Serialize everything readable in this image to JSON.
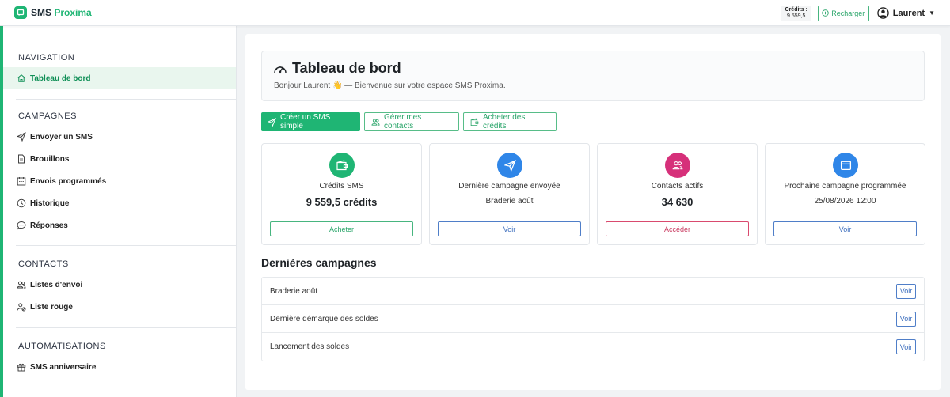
{
  "app": {
    "logo_prefix": "SMS",
    "logo_suffix": "Proxima",
    "brand_color": "#1fb574"
  },
  "topbar": {
    "credits_label": "Crédits :",
    "credits_value": "9 559,5",
    "recharge_label": "Recharger",
    "user_name": "Laurent"
  },
  "sidebar": {
    "sections": [
      {
        "heading": "NAVIGATION",
        "items": [
          {
            "label": "Tableau de bord",
            "icon": "home-icon",
            "active": true
          }
        ]
      },
      {
        "heading": "CAMPAGNES",
        "items": [
          {
            "label": "Envoyer un SMS",
            "icon": "send-icon"
          },
          {
            "label": "Brouillons",
            "icon": "file-icon"
          },
          {
            "label": "Envois programmés",
            "icon": "calendar-icon"
          },
          {
            "label": "Historique",
            "icon": "clock-icon"
          },
          {
            "label": "Réponses",
            "icon": "chat-icon"
          }
        ]
      },
      {
        "heading": "CONTACTS",
        "items": [
          {
            "label": "Listes d'envoi",
            "icon": "users-icon"
          },
          {
            "label": "Liste rouge",
            "icon": "user-block-icon"
          }
        ]
      },
      {
        "heading": "AUTOMATISATIONS",
        "items": [
          {
            "label": "SMS anniversaire",
            "icon": "gift-icon"
          }
        ]
      }
    ]
  },
  "header": {
    "title": "Tableau de bord",
    "subtitle": "Bonjour Laurent 👋 — Bienvenue sur votre espace SMS Proxima."
  },
  "actions": {
    "create_sms": "Créer un SMS simple",
    "manage_contacts": "Gérer mes contacts",
    "buy_credits": "Acheter des crédits"
  },
  "stats": [
    {
      "label": "Crédits SMS",
      "value": "9 559,5 crédits",
      "button": "Acheter",
      "color": "#1fb574",
      "btn_color": "#47b57f",
      "icon": "wallet-icon"
    },
    {
      "label": "Dernière campagne envoyée",
      "value": "Braderie août",
      "button": "Voir",
      "color": "#2f86e8",
      "btn_color": "#4f7ec8",
      "icon": "send-icon"
    },
    {
      "label": "Contacts actifs",
      "value": "34 630",
      "button": "Accéder",
      "color": "#d6307a",
      "btn_color": "#d94a6e",
      "icon": "users-icon"
    },
    {
      "label": "Prochaine campagne programmée",
      "value": "25/08/2026 12:00",
      "button": "Voir",
      "color": "#2f86e8",
      "btn_color": "#4f7ec8",
      "icon": "calendar-icon"
    }
  ],
  "campaigns": {
    "title": "Dernières campagnes",
    "rows": [
      {
        "name": "Braderie août",
        "button": "Voir"
      },
      {
        "name": "Dernière démarque des soldes",
        "button": "Voir"
      },
      {
        "name": "Lancement des soldes",
        "button": "Voir"
      }
    ]
  }
}
